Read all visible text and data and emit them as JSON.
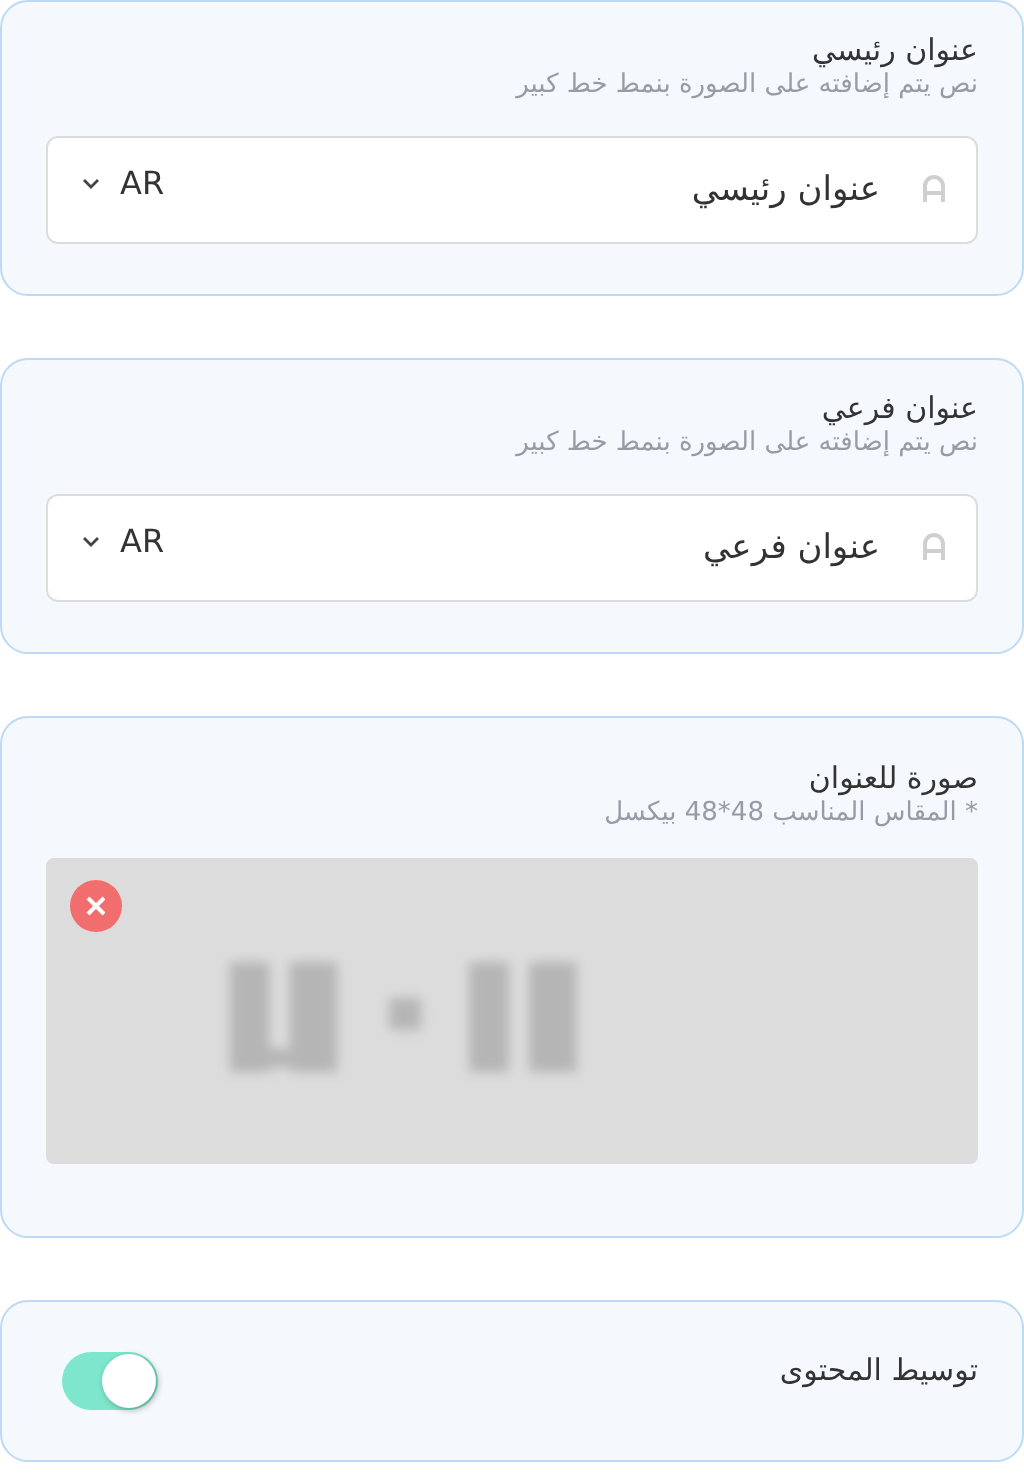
{
  "sections": [
    {
      "kind": "text",
      "title": "عنوان رئيسي",
      "hint": "نص يتم إضافته على الصورة بنمط خط كبير",
      "value": "عنوان رئيسي",
      "language": "AR"
    },
    {
      "kind": "text",
      "title": "عنوان فرعي",
      "hint": "نص يتم إضافته على الصورة بنمط خط كبير",
      "value": "عنوان فرعي",
      "language": "AR"
    },
    {
      "title": "صورة للعنوان",
      "hint": "* المقاس المناسب 48*48 بيكسل"
    },
    {
      "kind": "toggle",
      "title": "توسيط المحتوى",
      "on": true
    }
  ]
}
